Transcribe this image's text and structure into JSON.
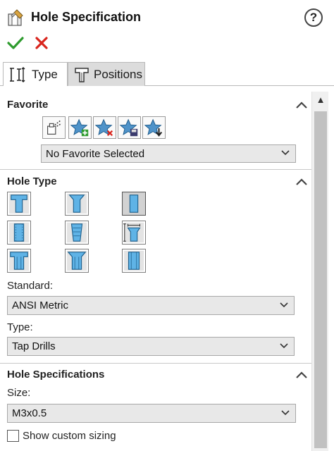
{
  "header": {
    "title": "Hole Specification",
    "help_label": "?",
    "title_icon": "hole-wizard-icon",
    "ok_icon": "checkmark-icon",
    "cancel_icon": "x-icon"
  },
  "tabs": [
    {
      "label": "Type",
      "active": true,
      "icon": "type-dimension-icon"
    },
    {
      "label": "Positions",
      "active": false,
      "icon": "positions-icon"
    }
  ],
  "favorite": {
    "title": "Favorite",
    "buttons": [
      "apply-defaults-icon",
      "add-favorite-icon",
      "delete-favorite-icon",
      "save-favorite-icon",
      "load-favorite-icon"
    ],
    "selected": "No Favorite Selected"
  },
  "hole_type": {
    "title": "Hole Type",
    "types": [
      [
        "counterbore",
        "countersink",
        "hole"
      ],
      [
        "straight-tap",
        "tapered-tap",
        "legacy"
      ],
      [
        "counterbore-slot",
        "countersink-slot",
        "slot"
      ]
    ],
    "selected": "hole",
    "standard_label": "Standard:",
    "standard_value": "ANSI Metric",
    "type_label": "Type:",
    "type_value": "Tap Drills"
  },
  "hole_specifications": {
    "title": "Hole Specifications",
    "size_label": "Size:",
    "size_value": "M3x0.5",
    "custom_sizing_label": "Show custom sizing",
    "custom_sizing_checked": false
  },
  "colors": {
    "accent_blue": "#4aa3df",
    "ok_green": "#2e9b2e",
    "cancel_red": "#d9251d",
    "star_blue": "#2f7fbf"
  }
}
